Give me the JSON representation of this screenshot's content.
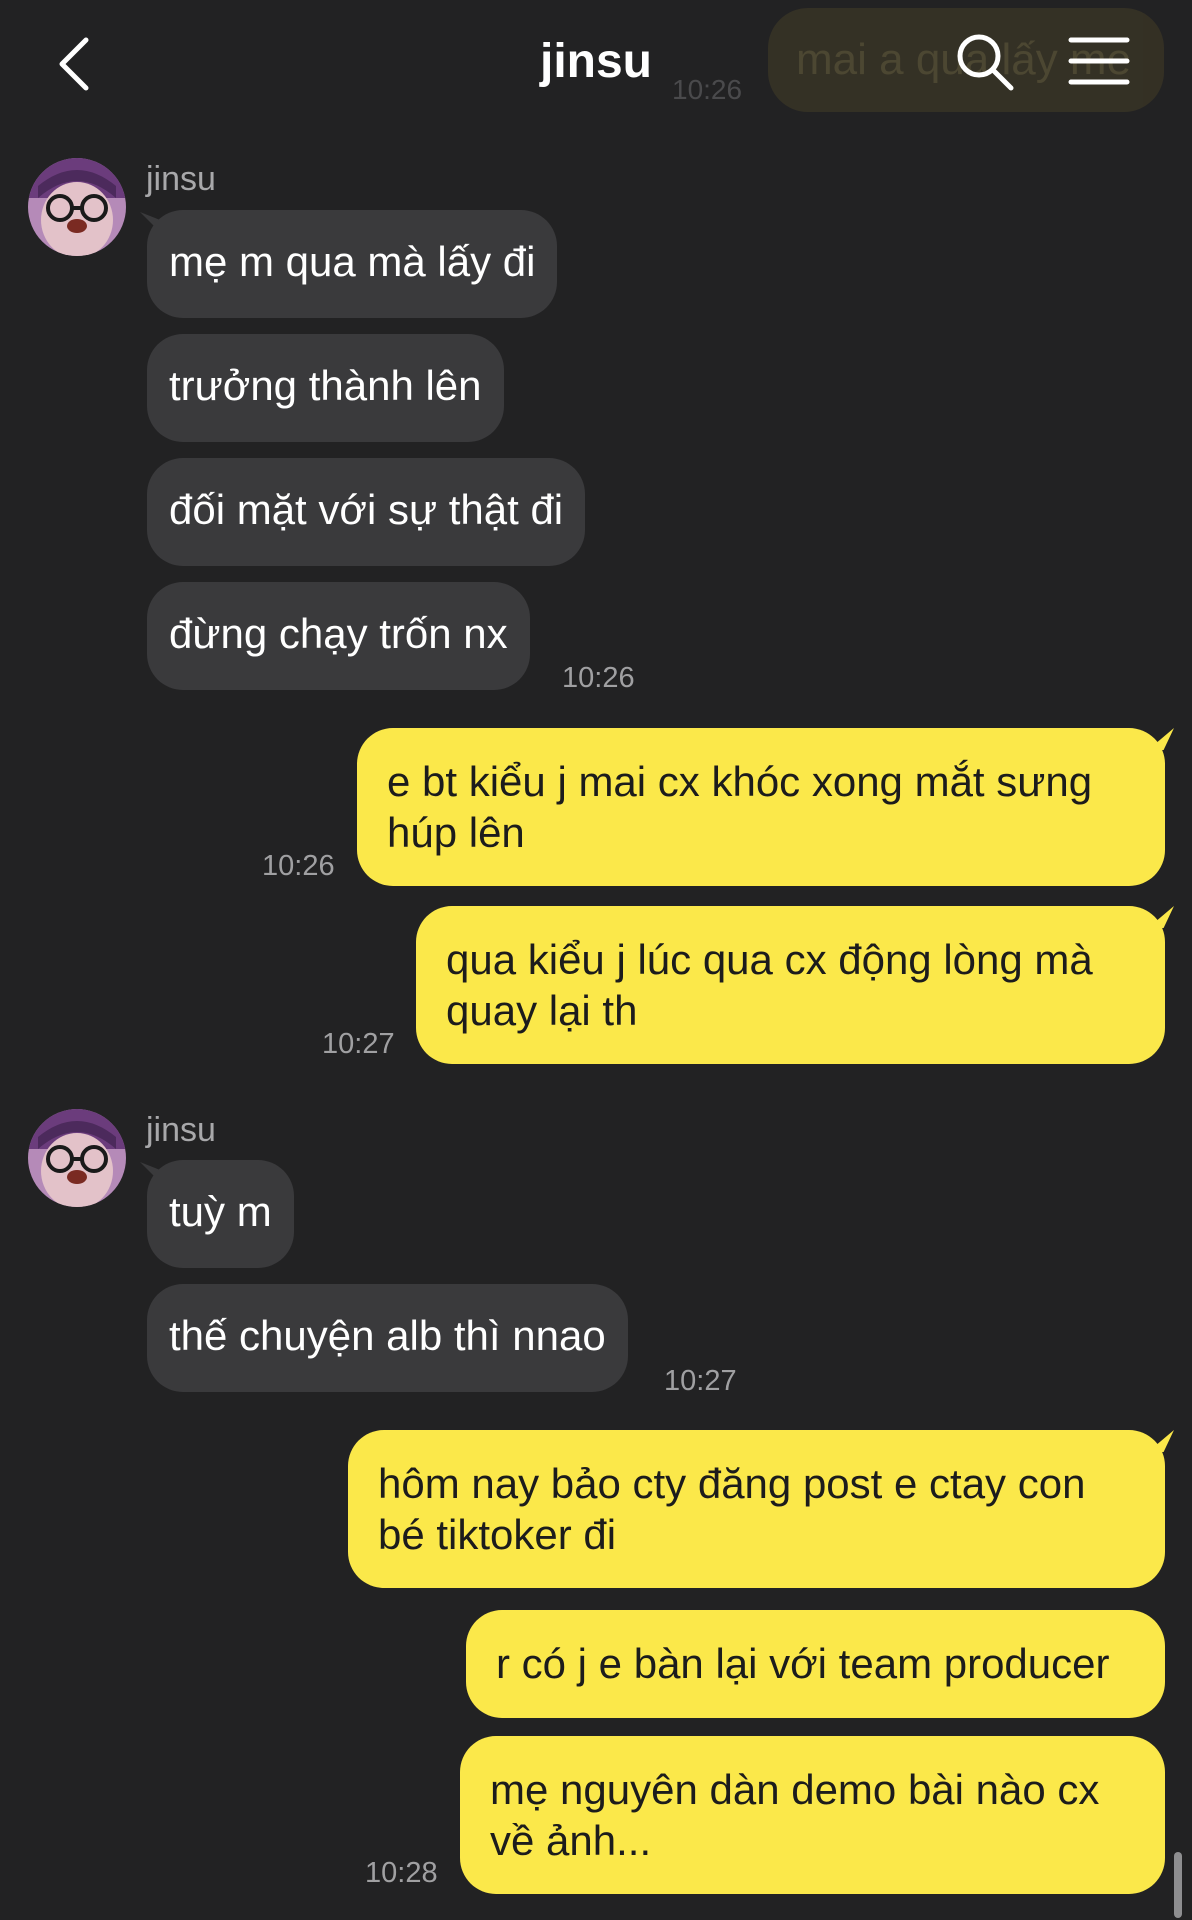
{
  "header": {
    "title": "jinsu",
    "ghost_message": "mai a qua lấy me",
    "ghost_time": "10:26"
  },
  "groups": [
    {
      "sender": "jinsu",
      "messages": [
        "mẹ m qua mà lấy đi",
        "trưởng thành lên",
        "đối mặt với sự thật đi",
        "đừng chạy trốn nx"
      ],
      "time": "10:26"
    },
    {
      "sender": "jinsu",
      "messages": [
        "tuỳ m",
        "thế chuyện alb thì nnao"
      ],
      "time": "10:27"
    }
  ],
  "outgoing": [
    {
      "lines": [
        "e bt kiểu j mai cx khóc xong mắt sưng",
        "húp lên"
      ],
      "time": "10:26"
    },
    {
      "lines": [
        "qua kiểu j lúc qua cx động lòng mà",
        "quay lại th"
      ],
      "time": "10:27"
    },
    {
      "lines": [
        "hôm nay bảo cty đăng post e ctay con",
        "bé tiktoker đi"
      ],
      "time": ""
    },
    {
      "lines": [
        "r có j e bàn lại với team producer"
      ],
      "time": ""
    },
    {
      "lines": [
        "mẹ nguyên dàn demo bài nào cx",
        "về ảnh..."
      ],
      "time": "10:28"
    }
  ],
  "icons": {
    "back": "chevron-left-icon",
    "search": "search-icon",
    "menu": "hamburger-menu-icon"
  },
  "colors": {
    "background": "#222223",
    "incoming_bubble": "#3a3a3c",
    "outgoing_bubble": "#fbe84a",
    "time_text": "#a0a0a2"
  }
}
